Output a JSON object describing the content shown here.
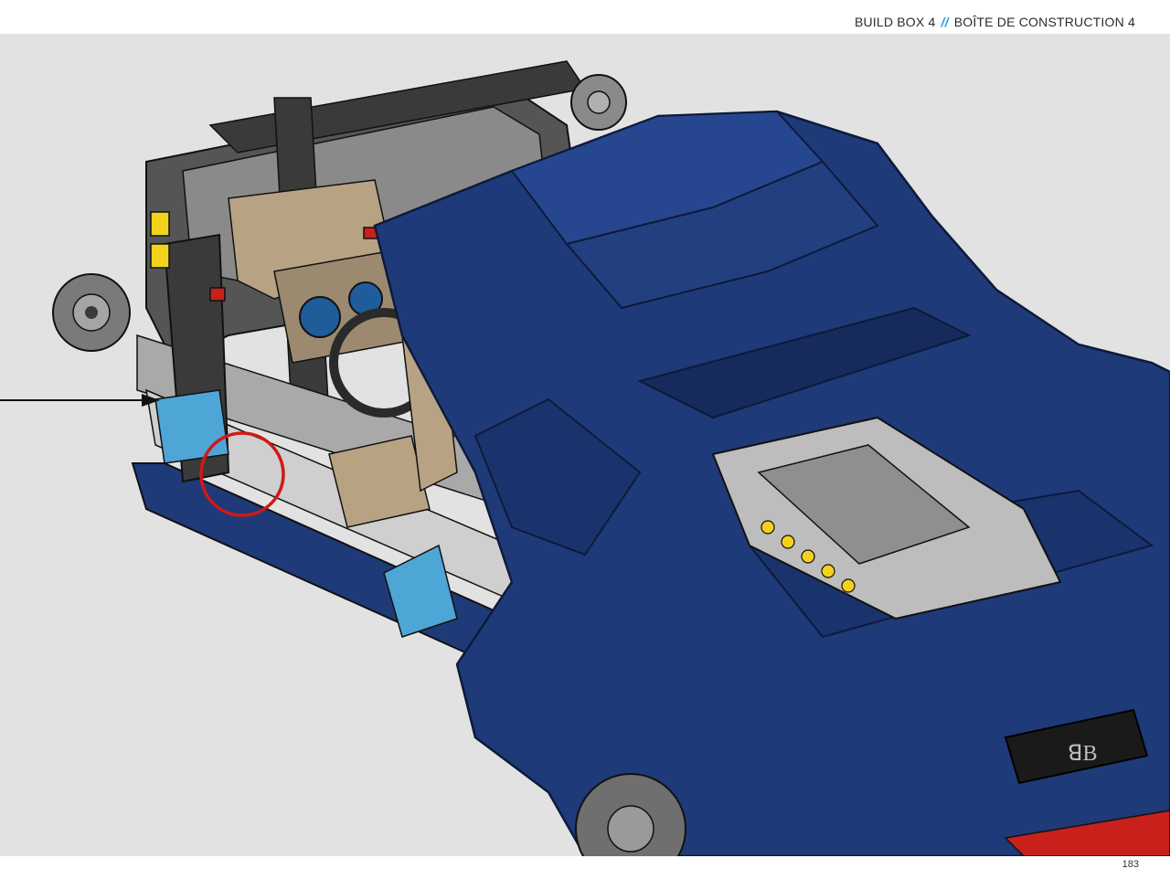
{
  "header": {
    "build_box": "BUILD BOX 4",
    "separator": "//",
    "build_box_fr": "BOÎTE DE CONSTRUCTION 4"
  },
  "page_number": "183",
  "colors": {
    "background": "#e2e2e2",
    "car_body": "#1f3a78",
    "car_body_dark": "#162b5c",
    "frame_dark": "#3a3a3a",
    "frame_light": "#a9a9a9",
    "accent_blue": "#1f9fd8",
    "highlight_circle": "#d01818",
    "tan": "#b8a284",
    "yellow": "#f3d21c",
    "red": "#c8201b"
  }
}
